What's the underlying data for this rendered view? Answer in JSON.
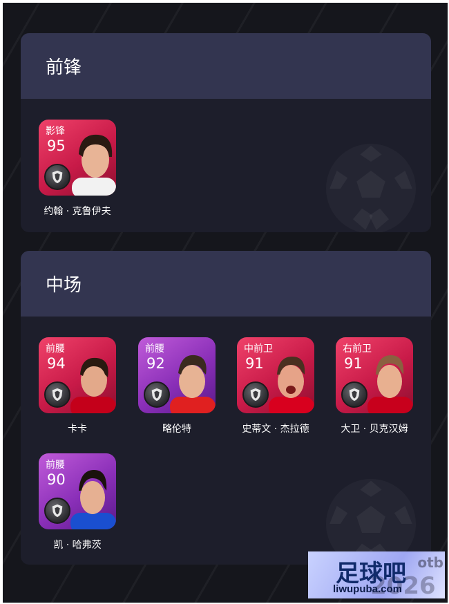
{
  "sections": [
    {
      "title": "前锋",
      "players": [
        {
          "position": "影锋",
          "rating": "95",
          "name": "约翰 · 克鲁伊夫",
          "card": "red",
          "face_skin": "#e8b496",
          "hair": "#2a1a12",
          "shirt": "#f2f2f2"
        }
      ]
    },
    {
      "title": "中场",
      "players": [
        {
          "position": "前腰",
          "rating": "94",
          "name": "卡卡",
          "card": "red",
          "face_skin": "#e3a98a",
          "hair": "#2a1a10",
          "shirt": "#c4001a"
        },
        {
          "position": "前腰",
          "rating": "92",
          "name": "略伦特",
          "card": "purple",
          "face_skin": "#e7b394",
          "hair": "#3a2a1e",
          "shirt": "#e02020"
        },
        {
          "position": "中前卫",
          "rating": "91",
          "name": "史蒂文 · 杰拉德",
          "card": "red",
          "face_skin": "#e6a388",
          "hair": "#4a3020",
          "shirt": "#d8001e"
        },
        {
          "position": "右前卫",
          "rating": "91",
          "name": "大卫 · 贝克汉姆",
          "card": "red",
          "face_skin": "#e8b090",
          "hair": "#8a6040",
          "shirt": "#c8001c"
        },
        {
          "position": "前腰",
          "rating": "90",
          "name": "凯 · 哈弗茨",
          "card": "purple",
          "face_skin": "#e6b092",
          "hair": "#1a120c",
          "shirt": "#1a4fd0"
        }
      ]
    }
  ],
  "watermark": {
    "brand": "足球吧",
    "url": "liwupuba.com",
    "bg_text": "otb",
    "bg_text2": "2026"
  }
}
